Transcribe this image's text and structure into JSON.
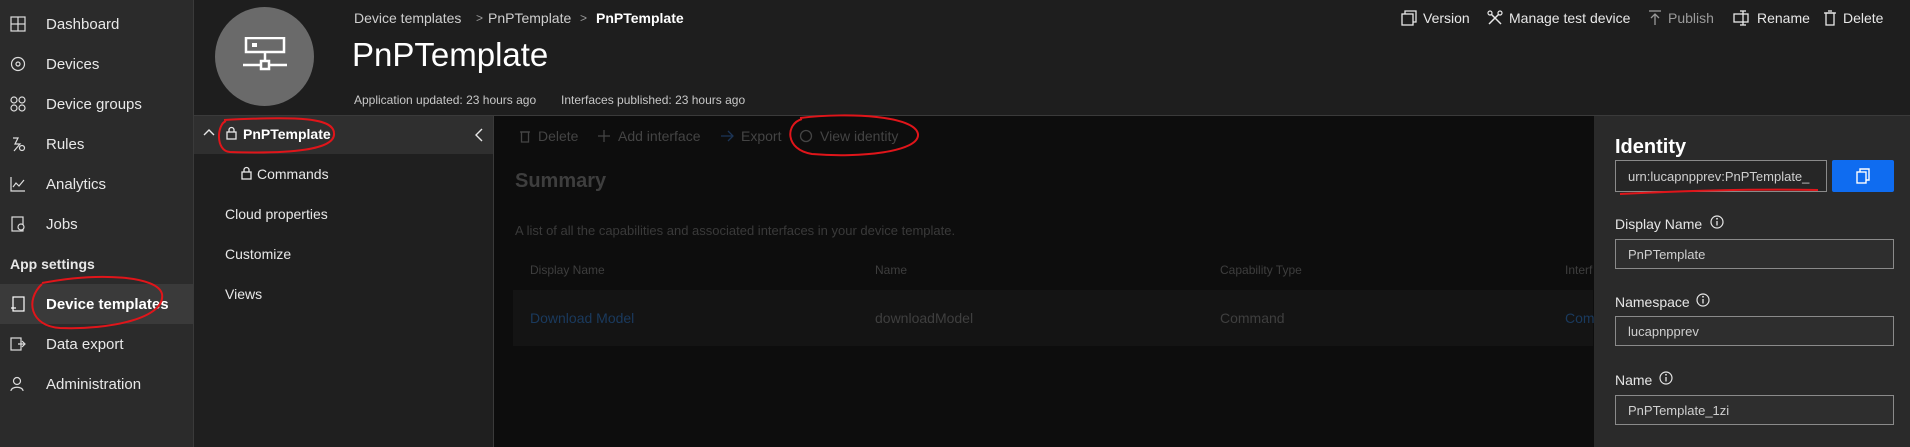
{
  "nav": {
    "items": [
      {
        "label": "Dashboard",
        "icon": "dashboard-icon"
      },
      {
        "label": "Devices",
        "icon": "devices-icon"
      },
      {
        "label": "Device groups",
        "icon": "device-groups-icon"
      },
      {
        "label": "Rules",
        "icon": "rules-icon"
      },
      {
        "label": "Analytics",
        "icon": "analytics-icon"
      },
      {
        "label": "Jobs",
        "icon": "jobs-icon"
      }
    ],
    "section": "App settings",
    "settings_items": [
      {
        "label": "Device templates",
        "icon": "device-templates-icon",
        "active": true
      },
      {
        "label": "Data export",
        "icon": "data-export-icon"
      },
      {
        "label": "Administration",
        "icon": "administration-icon"
      }
    ]
  },
  "header": {
    "breadcrumbs": [
      "Device templates",
      "PnPTemplate",
      "PnPTemplate"
    ],
    "title": "PnPTemplate",
    "app_updated": "Application updated: 23 hours ago",
    "interfaces_published": "Interfaces published: 23 hours ago",
    "actions": {
      "version": "Version",
      "manage_test": "Manage test device",
      "publish": "Publish",
      "rename": "Rename",
      "delete": "Delete"
    }
  },
  "tree": {
    "root": "PnPTemplate",
    "commands": "Commands",
    "cloud_properties": "Cloud properties",
    "customize": "Customize",
    "views": "Views"
  },
  "toolbar": {
    "delete": "Delete",
    "add_interface": "Add interface",
    "export": "Export",
    "view_identity": "View identity"
  },
  "summary": {
    "title": "Summary",
    "description": "A list of all the capabilities and associated interfaces in your device template.",
    "columns": [
      "Display Name",
      "Name",
      "Capability Type",
      "Interf"
    ],
    "rows": [
      {
        "display_name": "Download Model",
        "name": "downloadModel",
        "type": "Command",
        "interface": "Comm"
      }
    ]
  },
  "identity": {
    "title": "Identity",
    "id_value": "urn:lucapnpprev:PnPTemplate_",
    "display_name_label": "Display Name",
    "display_name_value": "PnPTemplate",
    "namespace_label": "Namespace",
    "namespace_value": "lucapnpprev",
    "name_label": "Name",
    "name_value": "PnPTemplate_1zi"
  },
  "colors": {
    "accent": "#0f6cf0",
    "annotation": "#e0151a"
  }
}
